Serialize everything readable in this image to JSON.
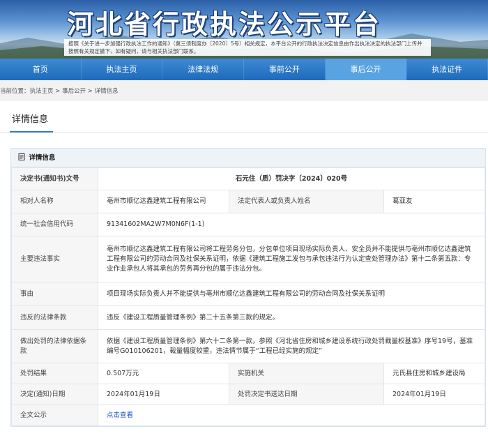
{
  "header": {
    "title": "河北省行政执法公示平台",
    "notice": "按照《关于进一步加强行政执法工作的通知》（冀三须制度办〔2020〕5号）相关规定，本平台公开的行政执法决定信息由作出执法决定的执法部门上传并按照有关规定撤下，如有疑问，请与相关执法部门联系。"
  },
  "nav": {
    "items": [
      "首页",
      "执法主页",
      "法律法规",
      "事前公开",
      "事后公开",
      "执法证件"
    ],
    "active_index": 4
  },
  "breadcrumb": {
    "prefix": "当前位置：",
    "items": [
      "执法主页",
      "事后公开",
      "详情信息"
    ],
    "separator": " > "
  },
  "page_title": "详情信息",
  "panel_title": "详情信息",
  "colors": {
    "nav_bg": "#1f6bbb",
    "nav_active": "#5aa3e2",
    "accent": "#2e78c7",
    "link": "#1a56c4"
  },
  "detail": {
    "doc_no_label": "决定书(通知书)文号",
    "doc_no": "石元住（质）罚决字〔2024〕020号",
    "party_label": "相对人名称",
    "party": "亳州市顺亿达鑫建筑工程有限公司",
    "rep_label": "法定代表人或负责人姓名",
    "rep": "葛亚友",
    "credit_label": "统一社会信用代码",
    "credit": "91341602MA2W7M0N6F(1-1)",
    "facts_label": "主要违法事实",
    "facts": "亳州市顺亿达鑫建筑工程有限公司将工程劳务分包，分包单位项目现场实际负责人、安全员并不能提供与亳州市顺亿达鑫建筑工程有限公司的劳动合同及社保关系证明，依据《建筑工程施工发包与承包违法行为认定查处管理办法》第十二条第五款：专业作业承包人将其承包的劳务再分包的属于违法分包。",
    "reason_label": "事由",
    "reason": "项目现场实际负责人并不能提供与亳州市顺亿达鑫建筑工程有限公司的劳动合同及社保关系证明",
    "law_label": "违反的法律条款",
    "law": "违反《建设工程质量管理条例》第二十五条第三款的规定。",
    "basis_label": "做出处罚的法律依据条款",
    "basis": "依据《建设工程质量管理条例》第六十二条第一款，参照《河北省住房和城乡建设系统行政处罚裁量权基准》序号19号，基准编号G010106201，裁量幅度较重，违法情节属于“工程已经实施的规定”",
    "result_label": "处罚结果",
    "result": "0.507万元",
    "agency_label": "实施机关",
    "agency": "元氏县住房和城乡建设局",
    "date_label": "决定(通知)日期",
    "date": "2024年01月19日",
    "delivery_label": "处罚决定书送达日期",
    "delivery": "2024年01月19日",
    "full_label": "全文公示",
    "full_link": "点击查看"
  }
}
